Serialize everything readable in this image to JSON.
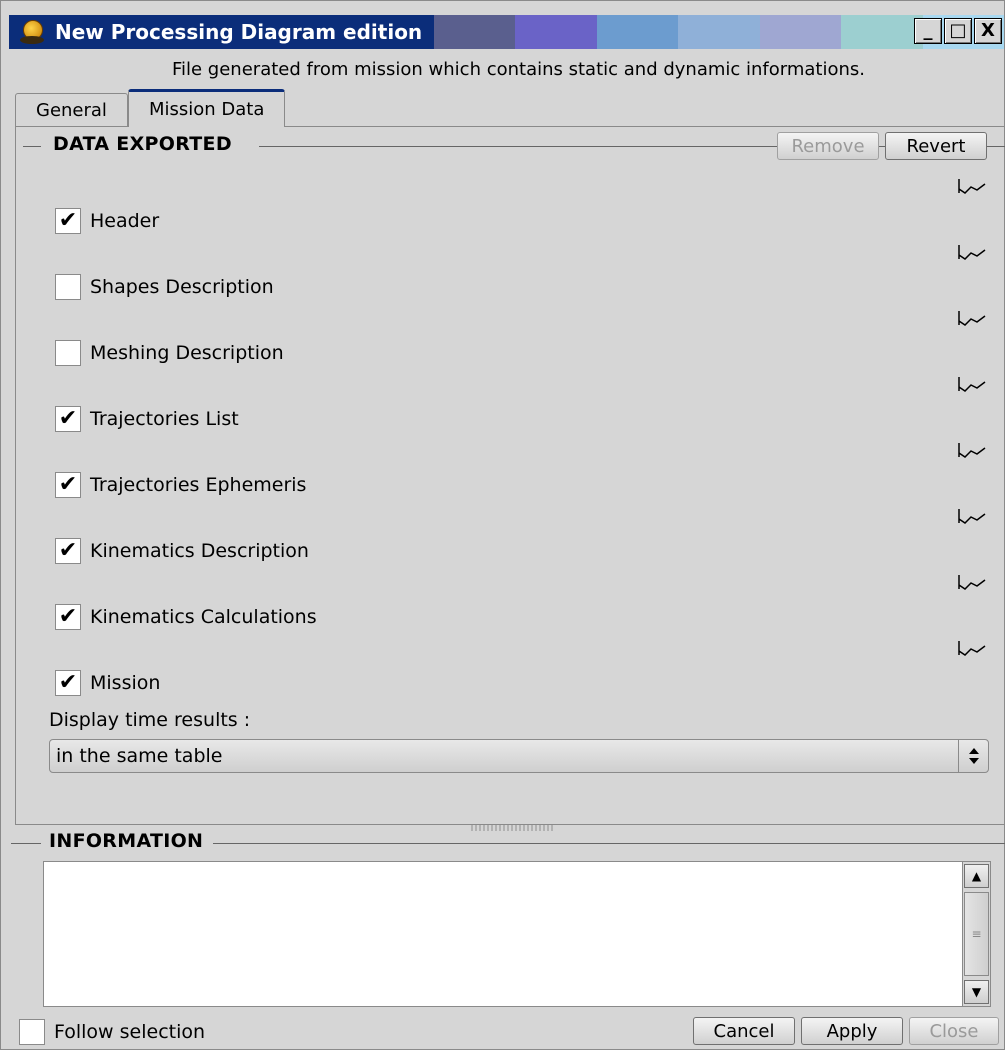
{
  "window": {
    "title": "New Processing Diagram edition",
    "subtitle": "File generated from mission which contains static and dynamic informations.",
    "title_colors": [
      "#5a5f8e",
      "#6a63c7",
      "#6c9ccf",
      "#8fb0d8",
      "#9fa7d2",
      "#9ccfd0",
      "#a8d8f0"
    ],
    "controls": {
      "minimize": "_",
      "maximize": "□",
      "close": "X"
    }
  },
  "tabs": [
    {
      "label": "General",
      "active": false
    },
    {
      "label": "Mission Data",
      "active": true
    }
  ],
  "data_exported": {
    "title": "DATA EXPORTED",
    "remove_label": "Remove",
    "revert_label": "Revert",
    "items": [
      {
        "label": "Header",
        "checked": true
      },
      {
        "label": "Shapes Description",
        "checked": false
      },
      {
        "label": "Meshing Description",
        "checked": false
      },
      {
        "label": "Trajectories List",
        "checked": true
      },
      {
        "label": "Trajectories Ephemeris",
        "checked": true
      },
      {
        "label": "Kinematics Description",
        "checked": true
      },
      {
        "label": "Kinematics Calculations",
        "checked": true
      },
      {
        "label": "Mission",
        "checked": true
      }
    ],
    "display_label": "Display time results :",
    "display_value": "in the same table"
  },
  "information": {
    "title": "INFORMATION",
    "text": ""
  },
  "footer": {
    "follow_label": "Follow selection",
    "follow_checked": false,
    "cancel_label": "Cancel",
    "apply_label": "Apply",
    "close_label": "Close"
  },
  "colors": {
    "titlebar": "#0b2d7a",
    "background": "#d6d6d6"
  }
}
